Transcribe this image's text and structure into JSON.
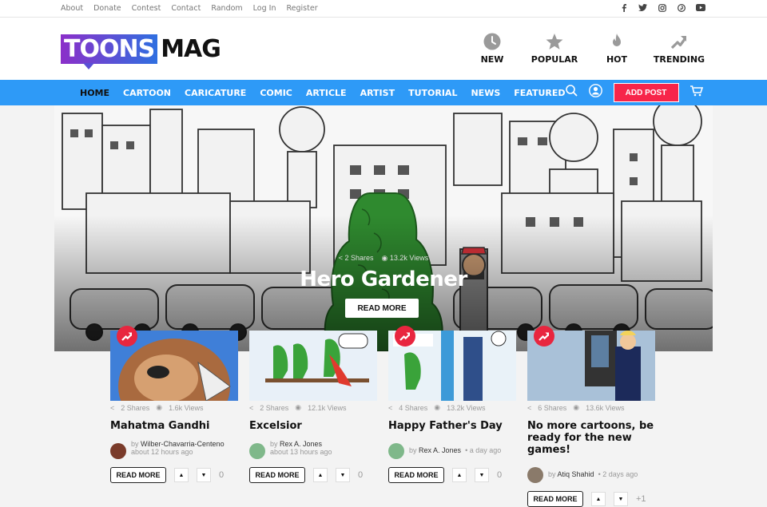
{
  "topbar": {
    "links": [
      "About",
      "Donate",
      "Contest",
      "Contact",
      "Random",
      "Log In",
      "Register"
    ],
    "social_icons": [
      "facebook-icon",
      "twitter-icon",
      "instagram-icon",
      "pinterest-icon",
      "youtube-icon"
    ]
  },
  "logo": {
    "part1": "TOONS",
    "part2": "MAG"
  },
  "header_nav": [
    {
      "label": "NEW",
      "icon": "clock-icon"
    },
    {
      "label": "POPULAR",
      "icon": "star-icon"
    },
    {
      "label": "HOT",
      "icon": "flame-icon"
    },
    {
      "label": "TRENDING",
      "icon": "trending-arrow-icon"
    }
  ],
  "menu": [
    "HOME",
    "CARTOON",
    "CARICATURE",
    "COMIC",
    "ARTICLE",
    "ARTIST",
    "TUTORIAL",
    "NEWS",
    "FEATURED"
  ],
  "add_post": "ADD POST",
  "hero": {
    "shares": "2 Shares",
    "views": "13.2k Views",
    "title": "Hero Gardener",
    "button": "READ MORE"
  },
  "cards": [
    {
      "shares": "2 Shares",
      "views": "1.6k Views",
      "title": "Mahatma Gandhi",
      "by": "by",
      "author": "Wilber-Chavarria-Centeno",
      "time": "about 12 hours ago",
      "button": "READ MORE",
      "votes": "0"
    },
    {
      "shares": "2 Shares",
      "views": "12.1k Views",
      "title": "Excelsior",
      "by": "by",
      "author": "Rex A. Jones",
      "time": "about 13 hours ago",
      "button": "READ MORE",
      "votes": "0"
    },
    {
      "shares": "4 Shares",
      "views": "13.2k Views",
      "title": "Happy Father's Day",
      "by": "by",
      "author": "Rex A. Jones",
      "time": "a day ago",
      "button": "READ MORE",
      "votes": "0"
    },
    {
      "shares": "6 Shares",
      "views": "13.6k Views",
      "title": "No more cartoons, be ready for the new games!",
      "by": "by",
      "author": "Atiq Shahid",
      "time": "2 days ago",
      "button": "READ MORE",
      "votes": "+1"
    }
  ],
  "colors": {
    "navbar": "#2e9af7",
    "add_post": "#f7254a",
    "badge": "#e8263f"
  }
}
